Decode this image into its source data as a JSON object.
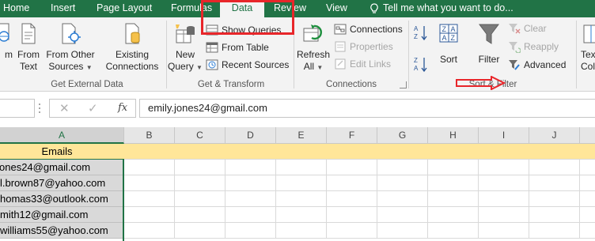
{
  "tabs": [
    "Home",
    "Insert",
    "Page Layout",
    "Formulas",
    "Data",
    "Review",
    "View"
  ],
  "active_tab": "Data",
  "tell_me": "Tell me what you want to do...",
  "ribbon": {
    "get_external": {
      "from_web": "m",
      "from_text_line1": "From",
      "from_text_line2": "Text",
      "from_other_line1": "From Other",
      "from_other_line2": "Sources",
      "existing_line1": "Existing",
      "existing_line2": "Connections",
      "group_label": "Get External Data"
    },
    "get_transform": {
      "new_query_line1": "New",
      "new_query_line2": "Query",
      "show_queries": "Show Queries",
      "from_table": "From Table",
      "recent_sources": "Recent Sources",
      "group_label": "Get & Transform"
    },
    "connections": {
      "refresh_line1": "Refresh",
      "refresh_line2": "All",
      "connections": "Connections",
      "properties": "Properties",
      "edit_links": "Edit Links",
      "group_label": "Connections"
    },
    "sort_filter": {
      "sort": "Sort",
      "filter": "Filter",
      "clear": "Clear",
      "reapply": "Reapply",
      "advanced": "Advanced",
      "group_label": "Sort & Filter"
    },
    "text_to_columns_line1": "Tex",
    "text_to_columns_line2": "Colu"
  },
  "formula_bar": {
    "fx_label": "fx",
    "value": "emily.jones24@gmail.com"
  },
  "sheet": {
    "columns": [
      "A",
      "B",
      "C",
      "D",
      "E",
      "F",
      "G",
      "H",
      "I",
      "J"
    ],
    "selected_column": "A",
    "header_cell": "Emails",
    "emails": [
      "ones24@gmail.com",
      "l.brown87@yahoo.com",
      "homas33@outlook.com",
      "mith12@gmail.com",
      "williams55@yahoo.com"
    ]
  },
  "colors": {
    "accent": "#217346",
    "header_fill": "#ffe699",
    "annotation_red": "#e8262a",
    "selection_fill": "#d9d9d9"
  },
  "icons": [
    "lightbulb-icon",
    "from-web-icon",
    "from-text-icon",
    "from-other-sources-icon",
    "existing-connections-icon",
    "new-query-icon",
    "show-queries-icon",
    "from-table-icon",
    "recent-sources-icon",
    "refresh-all-icon",
    "connections-icon",
    "properties-icon",
    "edit-links-icon",
    "sort-az-icon",
    "sort-za-icon",
    "sort-icon",
    "filter-icon",
    "clear-icon",
    "reapply-icon",
    "advanced-filter-icon",
    "text-to-columns-icon",
    "cancel-icon",
    "enter-check-icon"
  ]
}
